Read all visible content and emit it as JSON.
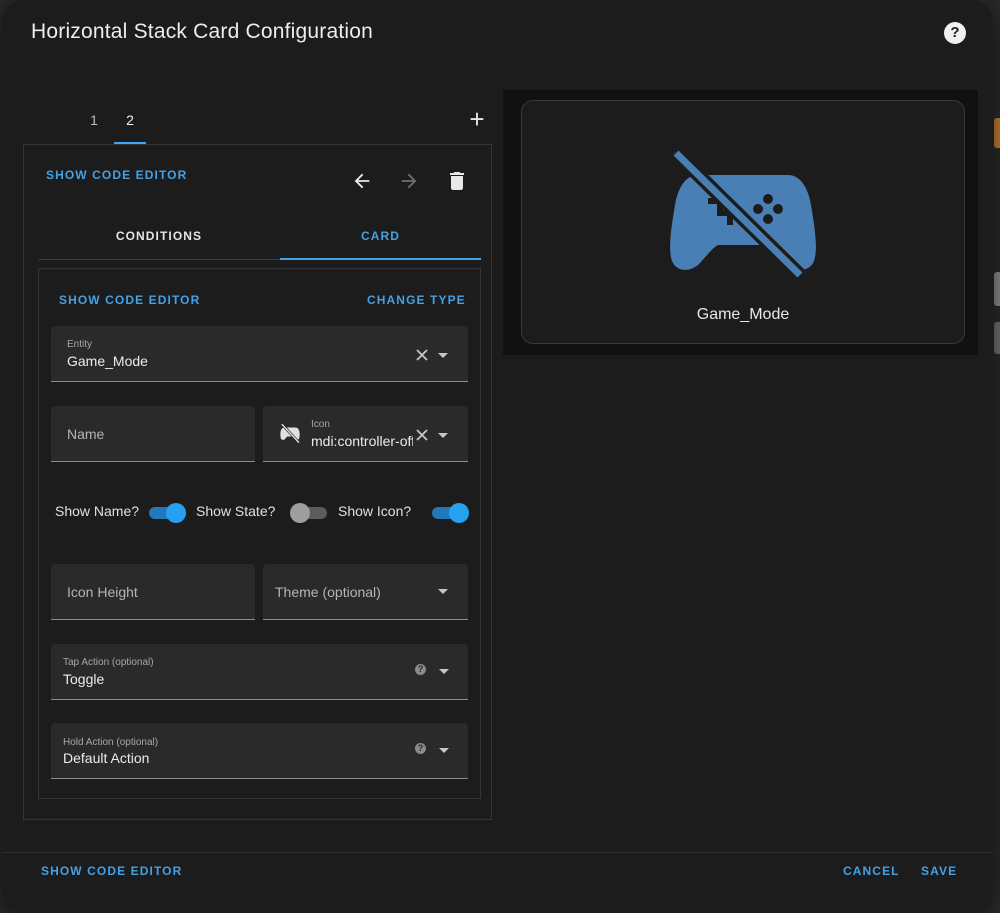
{
  "dialog": {
    "title": "Horizontal Stack Card Configuration"
  },
  "stack_tabs": [
    "1",
    "2"
  ],
  "editor": {
    "show_code_editor": "SHOW CODE EDITOR",
    "tabs": {
      "conditions": "CONDITIONS",
      "card": "CARD"
    }
  },
  "card_editor": {
    "show_code_editor": "SHOW CODE EDITOR",
    "change_type": "CHANGE TYPE",
    "entity": {
      "label": "Entity",
      "value": "Game_Mode"
    },
    "name": {
      "placeholder": "Name"
    },
    "icon": {
      "label": "Icon",
      "value": "mdi:controller-off"
    },
    "toggles": {
      "show_name": {
        "label": "Show Name?",
        "on": true
      },
      "show_state": {
        "label": "Show State?",
        "on": false
      },
      "show_icon": {
        "label": "Show Icon?",
        "on": true
      }
    },
    "icon_height": {
      "placeholder": "Icon Height"
    },
    "theme": {
      "placeholder": "Theme (optional)"
    },
    "tap_action": {
      "label": "Tap Action (optional)",
      "value": "Toggle"
    },
    "hold_action": {
      "label": "Hold Action (optional)",
      "value": "Default Action"
    }
  },
  "preview": {
    "name": "Game_Mode",
    "icon": "controller-off-icon",
    "icon_color": "#4a7fb5"
  },
  "footer": {
    "show_code_editor": "SHOW CODE EDITOR",
    "cancel": "CANCEL",
    "save": "SAVE"
  },
  "colors": {
    "accent": "#44a1e5",
    "surface": "#1c1c1c",
    "field": "#2a2a2a"
  }
}
